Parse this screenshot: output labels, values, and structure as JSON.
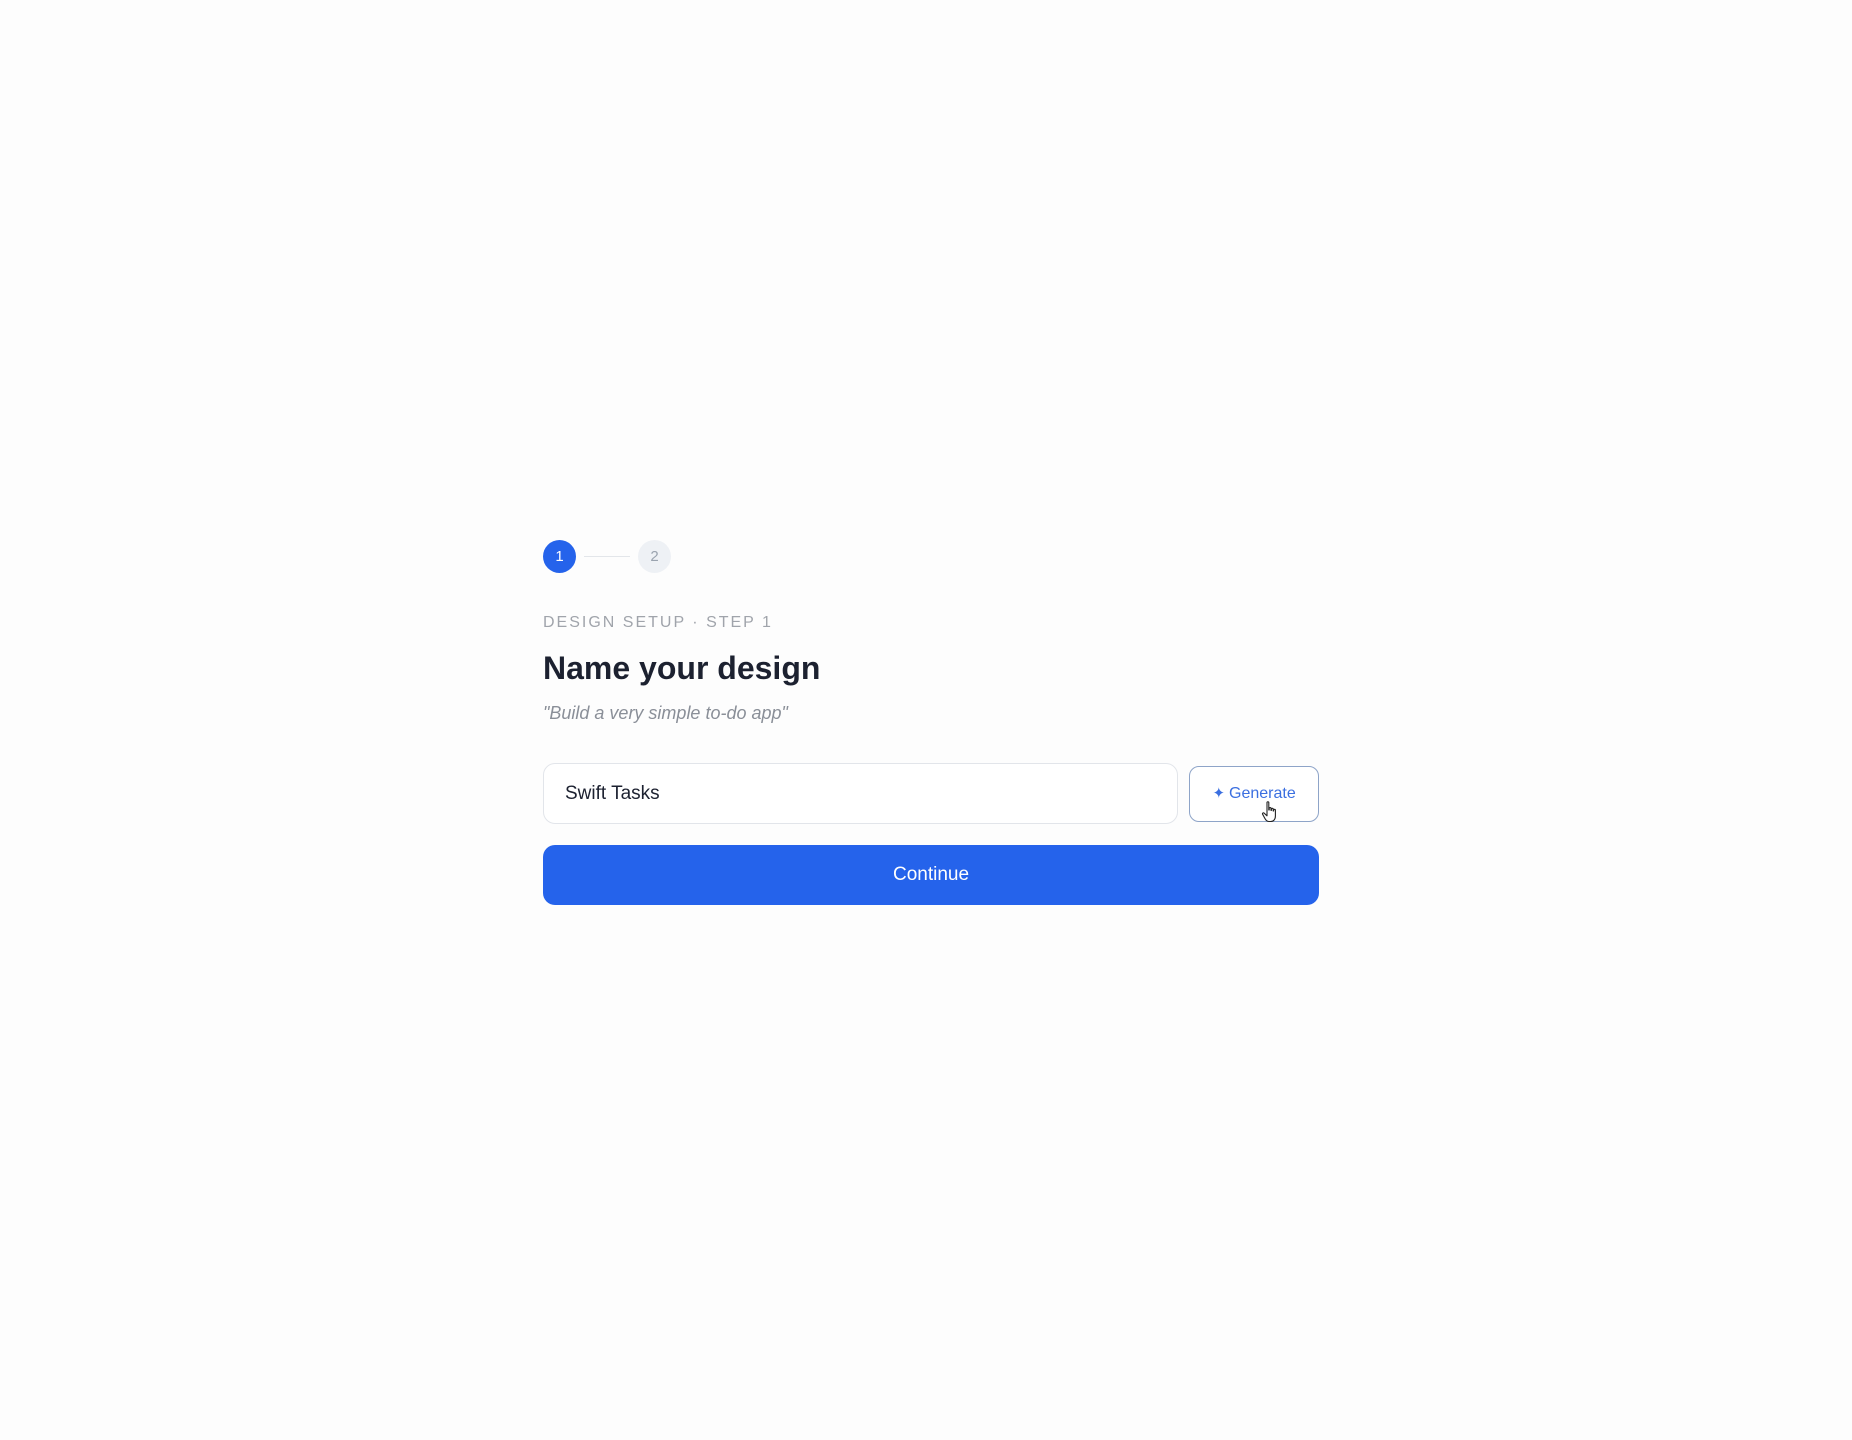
{
  "stepper": {
    "steps": [
      {
        "label": "1",
        "state": "active"
      },
      {
        "label": "2",
        "state": "inactive"
      }
    ]
  },
  "header": {
    "eyebrow": "DESIGN SETUP · STEP 1",
    "title": "Name your design",
    "subtitle": "\"Build a very simple to-do app\""
  },
  "form": {
    "name_value": "Swift Tasks",
    "generate_label": "Generate",
    "generate_icon": "sparkle-icon",
    "continue_label": "Continue"
  },
  "colors": {
    "accent": "#2563eb",
    "generate_text": "#3b6fe0",
    "title_text": "#1c2130",
    "muted_text": "#a0a4ab"
  },
  "cursor": {
    "icon": "hand-pointer-icon"
  }
}
